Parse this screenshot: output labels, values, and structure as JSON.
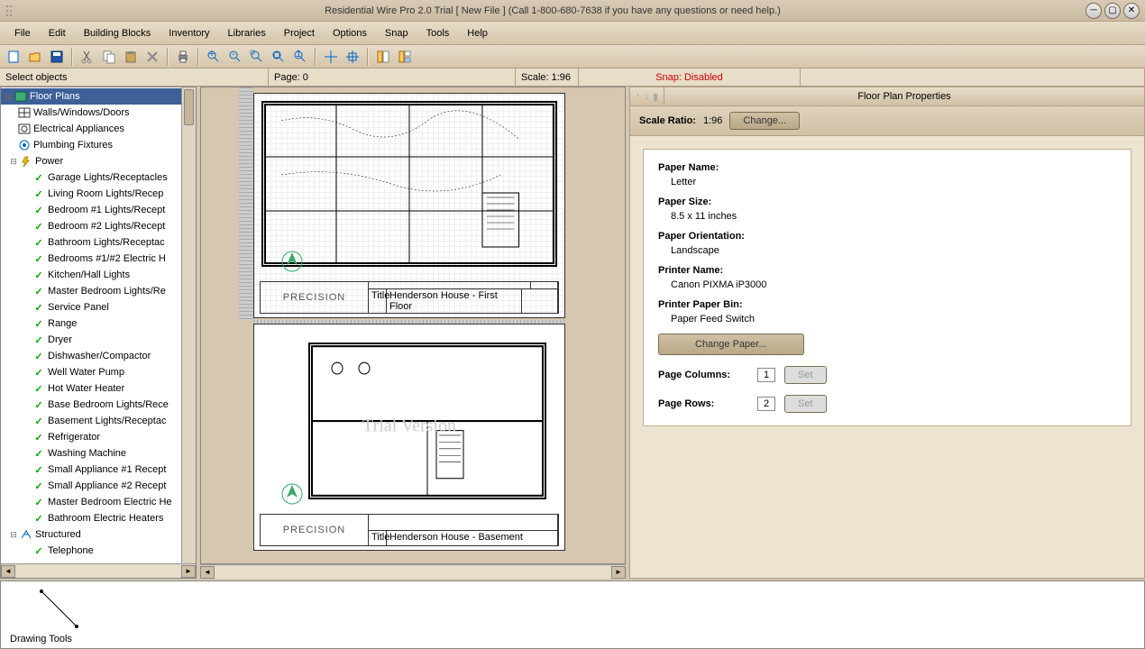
{
  "title": "Residential Wire Pro 2.0 Trial [ New File ]    (Call 1-800-680-7638 if you have any questions or need help.)",
  "menu": [
    "File",
    "Edit",
    "Building Blocks",
    "Inventory",
    "Libraries",
    "Project",
    "Options",
    "Snap",
    "Tools",
    "Help"
  ],
  "status": {
    "mode": "Select objects",
    "page": "Page: 0",
    "scale": "Scale: 1:96",
    "snap": "Snap: Disabled"
  },
  "tree": {
    "root": "Floor Plans",
    "cat1": "Walls/Windows/Doors",
    "cat2": "Electrical Appliances",
    "cat3": "Plumbing Fixtures",
    "power": "Power",
    "power_items": [
      "Garage Lights/Receptacles",
      "Living Room Lights/Recep",
      "Bedroom #1 Lights/Recept",
      "Bedroom #2 Lights/Recept",
      "Bathroom Lights/Receptac",
      "Bedrooms #1/#2 Electric H",
      "Kitchen/Hall Lights",
      "Master Bedroom Lights/Re",
      "Service Panel",
      "Range",
      "Dryer",
      "Dishwasher/Compactor",
      "Well Water Pump",
      "Hot Water Heater",
      "Base Bedroom Lights/Rece",
      "Basement Lights/Receptac",
      "Refrigerator",
      "Washing Machine",
      "Small Appliance #1 Recept",
      "Small Appliance #2 Recept",
      "Master Bedroom Electric He",
      "Bathroom Electric Heaters"
    ],
    "structured": "Structured",
    "structured_items": [
      "Telephone"
    ]
  },
  "props": {
    "title": "Floor Plan Properties",
    "scale_label": "Scale Ratio:",
    "scale_value": "1:96",
    "change": "Change...",
    "paper_name_l": "Paper Name:",
    "paper_name": "Letter",
    "paper_size_l": "Paper Size:",
    "paper_size": "8.5 x 11 inches",
    "orient_l": "Paper Orientation:",
    "orient": "Landscape",
    "printer_l": "Printer Name:",
    "printer": "Canon PIXMA iP3000",
    "bin_l": "Printer Paper Bin:",
    "bin": "Paper Feed Switch",
    "change_paper": "Change Paper...",
    "cols_l": "Page Columns:",
    "cols": "1",
    "rows_l": "Page Rows:",
    "rows": "2",
    "set": "Set"
  },
  "logo": "PRECISION",
  "watermark": "Trial Version",
  "drawing_tools": "Drawing Tools"
}
